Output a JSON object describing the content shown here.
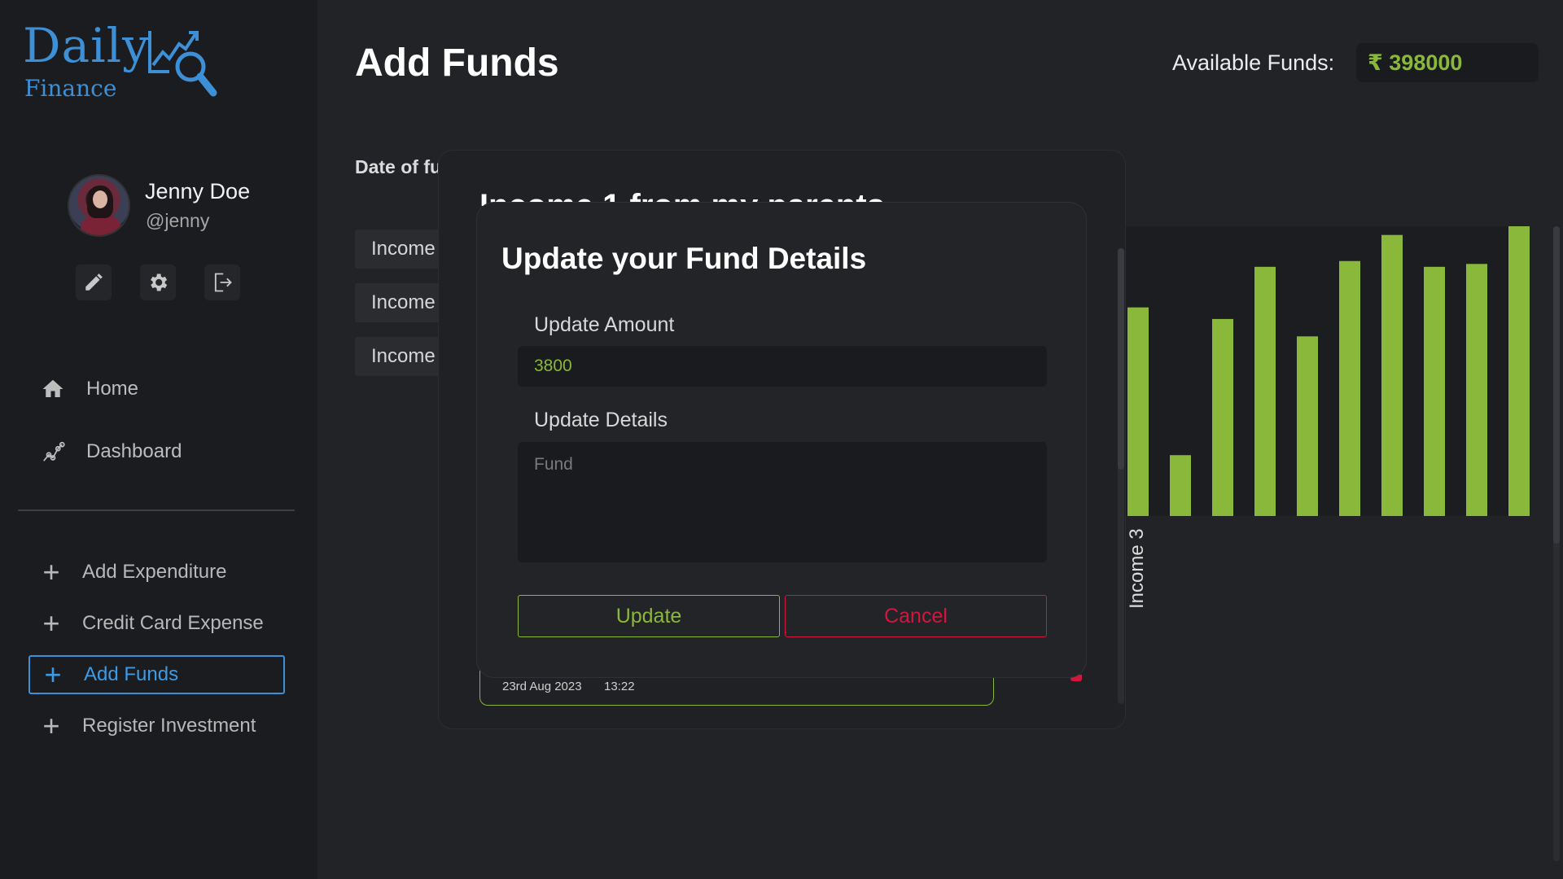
{
  "logo": {
    "word1": "Daily",
    "word2": "Finance",
    "color": "#3d8fd6"
  },
  "profile": {
    "name": "Jenny Doe",
    "handle": "@jenny"
  },
  "profile_actions": [
    "pencil-icon",
    "gear-icon",
    "logout-icon"
  ],
  "nav": [
    {
      "label": "Home",
      "icon": "home-icon"
    },
    {
      "label": "Dashboard",
      "icon": "chart-line-icon"
    }
  ],
  "menu": [
    {
      "label": "Add Expenditure",
      "active": false
    },
    {
      "label": "Credit Card Expense",
      "active": false
    },
    {
      "label": "Add Funds",
      "active": true
    },
    {
      "label": "Register Investment",
      "active": false
    }
  ],
  "header": {
    "title": "Add Funds",
    "funds_label": "Available Funds:",
    "funds_value": "₹ 398000"
  },
  "form": {
    "date_label": "Date of fu",
    "income_pills": [
      "Income",
      "Income",
      "Income"
    ]
  },
  "chart_data": {
    "type": "bar",
    "values": [
      72,
      21,
      68,
      86,
      62,
      88,
      97,
      86,
      87,
      100
    ],
    "xlabel": "Income 3",
    "color": "#8ab83a"
  },
  "outer_modal": {
    "title": "Income 1 from my parents",
    "card_date": "23rd Aug 2023",
    "card_time": "13:22"
  },
  "update_modal": {
    "title": "Update your Fund Details",
    "amount_label": "Update Amount",
    "amount_value": "3800",
    "details_label": "Update Details",
    "details_placeholder": "Fund",
    "update_button": "Update",
    "cancel_button": "Cancel"
  },
  "colors": {
    "accent_green": "#8ab83a",
    "accent_red": "#d3163f",
    "accent_blue": "#3d8fd6"
  }
}
